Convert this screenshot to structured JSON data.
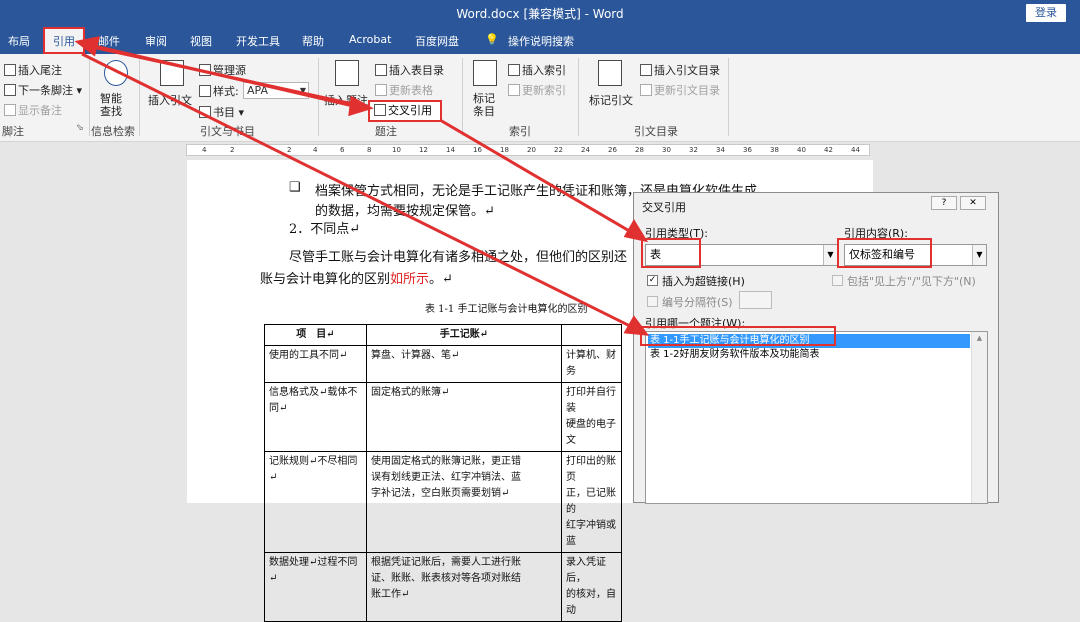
{
  "window": {
    "title": "Word.docx [兼容模式]  -  Word",
    "login": "登录"
  },
  "tabs": [
    "布局",
    "引用",
    "邮件",
    "审阅",
    "视图",
    "开发工具",
    "帮助",
    "Acrobat",
    "百度网盘",
    "操作说明搜索"
  ],
  "ribbon": {
    "footnotes": {
      "insert_endnote": "插入尾注",
      "next_footnote": "下一条脚注",
      "show_notes": "显示备注",
      "label": "脚注"
    },
    "research": {
      "smart_lookup": "智能\n查找",
      "label": "信息检索"
    },
    "citations": {
      "insert_citation": "插入引文",
      "manage_sources": "管理源",
      "style_label": "样式:",
      "style_value": "APA",
      "bibliography": "书目",
      "label": "引文与书目"
    },
    "captions": {
      "insert_caption": "插入题注",
      "insert_table_of_figures": "插入表目录",
      "update_table": "更新表格",
      "cross_reference": "交叉引用",
      "label": "题注"
    },
    "index": {
      "mark_entry": "标记\n条目",
      "insert_index": "插入索引",
      "update_index": "更新索引",
      "label": "索引"
    },
    "toa": {
      "mark_citation": "标记引文",
      "insert_toa": "插入引文目录",
      "update_toa": "更新引文目录",
      "label": "引文目录"
    }
  },
  "ruler": {
    "ticks": [
      "4",
      "2",
      "2",
      "4",
      "6",
      "8",
      "10",
      "12",
      "14",
      "16",
      "18",
      "20",
      "22",
      "24",
      "26",
      "28",
      "30",
      "32",
      "34",
      "36",
      "38",
      "40",
      "42",
      "44"
    ]
  },
  "document": {
    "bullet_line1": "档案保管方式相同，无论是手工记账产生的凭证和账簿，还是电算化软件生成",
    "bullet_line2": "的数据，均需要按规定保管。↵",
    "item2": "2．不同点↵",
    "para_line1": "尽管手工账与会计电算化有诸多相通之处，但他们的区别还",
    "para_line2_a": "账与会计电算化的区别",
    "para_line2_red": "如所示",
    "para_line2_b": "。↵",
    "caption": "表 1-1 手工记账与会计电算化的区别",
    "table": {
      "headers": [
        "项　目↵",
        "手工记账↵",
        ""
      ],
      "rows": [
        [
          "使用的工具不同↵",
          "算盘、计算器、笔↵",
          "计算机、财务"
        ],
        [
          "信息格式及↵载体不同↵",
          "固定格式的账簿↵",
          "打印并自行装\n硬盘的电子文"
        ],
        [
          "记账规则↵不尽相同↵",
          "使用固定格式的账簿记账，更正错\n误有划线更正法、红字冲销法、蓝\n字补记法，空白账页需要划销↵",
          "打印出的账页\n正，已记账的\n红字冲销或蓝"
        ],
        [
          "数据处理↵过程不同↵",
          "根据凭证记账后，需要人工进行账\n证、账账、账表核对等各项对账结\n账工作↵",
          "录入凭证后，\n的核对，自动"
        ]
      ]
    }
  },
  "dialog": {
    "title": "交叉引用",
    "help": "?",
    "close": "✕",
    "ref_type_label": "引用类型(T):",
    "ref_type_value": "表",
    "ref_content_label": "引用内容(R):",
    "ref_content_value": "仅标签和编号",
    "hyperlink_label": "插入为超链接(H)",
    "above_below_label": "包括\"见上方\"/\"见下方\"(N)",
    "separator_label": "编号分隔符(S)",
    "which_caption_label": "引用哪一个题注(W):",
    "captions": [
      "表 1-1手工记账与会计电算化的区别",
      "表 1-2好朋友财务软件版本及功能简表"
    ]
  },
  "colors": {
    "title_bg": "#2b579a",
    "highlight": "#e03030",
    "selection": "#3399ff"
  }
}
